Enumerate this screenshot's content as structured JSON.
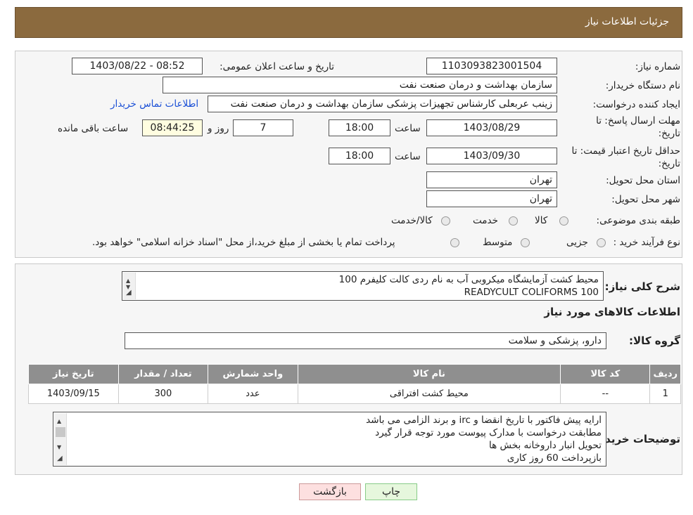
{
  "page_title": "جزئیات اطلاعات نیاز",
  "form": {
    "need_number_label": "شماره نیاز:",
    "need_number": "1103093823001504",
    "announce_label": "تاریخ و ساعت اعلان عمومی:",
    "announce_value": "1403/08/22 - 08:52",
    "buyer_org_label": "نام دستگاه خریدار:",
    "buyer_org": "سازمان بهداشت و درمان صنعت نفت",
    "creator_label": "ایجاد کننده درخواست:",
    "creator": "زینب عربعلی کارشناس تجهیزات پزشکی سازمان بهداشت و درمان صنعت نفت",
    "contact_link": "اطلاعات تماس خریدار",
    "deadline_label_1": "مهلت ارسال پاسخ: تا",
    "deadline_label_2": "تاریخ:",
    "deadline_date": "1403/08/29",
    "time_label": "ساعت",
    "deadline_time": "18:00",
    "days_value": "7",
    "days_label": "روز و",
    "remaining_time": "08:44:25",
    "remaining_label": "ساعت باقی مانده",
    "validity_label_1": "حداقل تاریخ اعتبار قیمت: تا",
    "validity_label_2": "تاریخ:",
    "validity_date": "1403/09/30",
    "validity_time": "18:00",
    "province_label": "استان محل تحویل:",
    "province": "تهران",
    "city_label": "شهر محل تحویل:",
    "city": "تهران",
    "category_label": "طبقه بندی موضوعی:",
    "category_options": [
      "کالا",
      "خدمت",
      "کالا/خدمت"
    ],
    "purchase_type_label": "نوع فرآیند خرید :",
    "purchase_options": [
      "جزیی",
      "متوسط"
    ],
    "purchase_note": "پرداخت تمام یا بخشی از مبلغ خرید،از محل \"اسناد خزانه اسلامی\" خواهد بود."
  },
  "description": {
    "label": "شرح کلی نیاز:",
    "line1": "محیط کشت آزمایشگاه میکروبی آب به نام ردی کالت کلیفرم 100",
    "line2": "READYCULT COLIFORMS 100"
  },
  "goods_section_title": "اطلاعات کالاهای مورد نیاز",
  "goods_group_label": "گروه کالا:",
  "goods_group": "دارو، پزشکی و سلامت",
  "table": {
    "headers": [
      "ردیف",
      "کد کالا",
      "نام کالا",
      "واحد شمارش",
      "تعداد / مقدار",
      "تاریخ نیاز"
    ],
    "rows": [
      [
        "1",
        "--",
        "محیط کشت افتراقی",
        "عدد",
        "300",
        "1403/09/15"
      ]
    ]
  },
  "buyer_notes": {
    "label": "توضیحات خریدار:",
    "lines": [
      "ارایه  پیش فاکتور با تاریخ انقضا و irc  و برند الزامی می باشد",
      "مطابقت درخواست با مدارک پیوست مورد توجه قرار گیرد",
      "تحویل انبار داروخانه بخش ها",
      "بازپرداخت 60 روز کاری"
    ]
  },
  "buttons": {
    "print": "چاپ",
    "back": "بازگشت"
  },
  "colors": {
    "header_bg": "#8b6a3e",
    "table_header_bg": "#8f8f8f",
    "link": "#1a4fd6",
    "back_button_bg": "#fde0e0",
    "print_button_bg": "#e6f7dd"
  }
}
